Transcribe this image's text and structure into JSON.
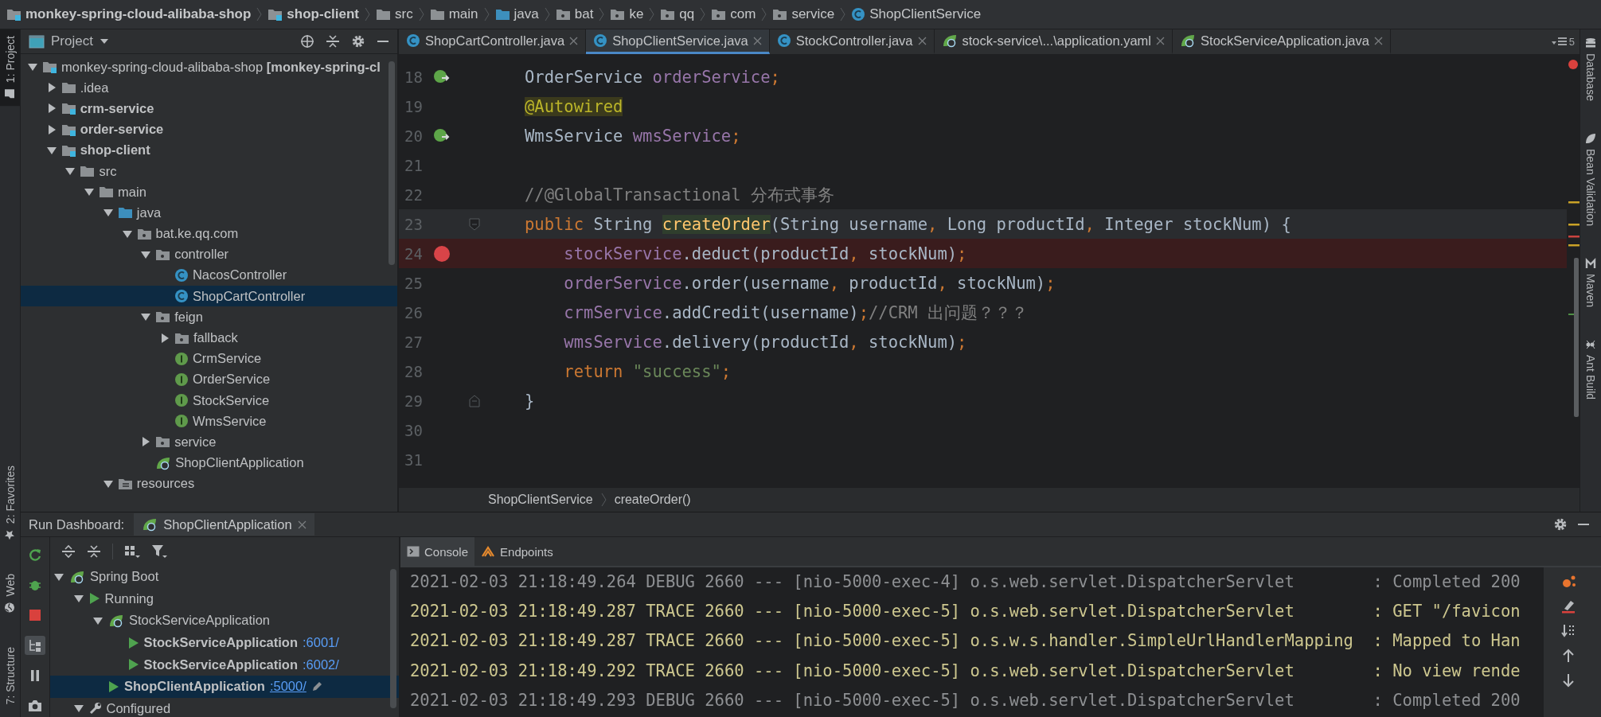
{
  "breadcrumb": [
    {
      "label": "monkey-spring-cloud-alibaba-shop",
      "kind": "module"
    },
    {
      "label": "shop-client",
      "kind": "module"
    },
    {
      "label": "src",
      "kind": "folder"
    },
    {
      "label": "main",
      "kind": "folder"
    },
    {
      "label": "java",
      "kind": "source"
    },
    {
      "label": "bat",
      "kind": "package"
    },
    {
      "label": "ke",
      "kind": "package"
    },
    {
      "label": "qq",
      "kind": "package"
    },
    {
      "label": "com",
      "kind": "package"
    },
    {
      "label": "service",
      "kind": "package"
    },
    {
      "label": "ShopClientService",
      "kind": "class"
    }
  ],
  "left_strip": [
    {
      "label": "1: Project",
      "kind": "project",
      "selected": true
    },
    {
      "label": "2: Favorites",
      "kind": "favorites",
      "selected": false
    },
    {
      "label": "Web",
      "kind": "web",
      "selected": false
    },
    {
      "label": "7: Structure",
      "kind": "structure",
      "selected": false
    }
  ],
  "project_panel": {
    "title": "Project",
    "tree": [
      {
        "label": "monkey-spring-cloud-alibaba-shop **[monkey-spring-cl**",
        "kind": "project",
        "expanded": true,
        "selected": false,
        "children": [
          {
            "label": ".idea",
            "kind": "folder",
            "expanded": false,
            "selected": false
          },
          {
            "label": "crm-service",
            "kind": "module",
            "expanded": false,
            "selected": false
          },
          {
            "label": "order-service",
            "kind": "module",
            "expanded": false,
            "selected": false
          },
          {
            "label": "shop-client",
            "kind": "module",
            "expanded": true,
            "selected": false,
            "children": [
              {
                "label": "src",
                "kind": "folder",
                "expanded": true,
                "selected": false,
                "children": [
                  {
                    "label": "main",
                    "kind": "folder",
                    "expanded": true,
                    "selected": false,
                    "children": [
                      {
                        "label": "java",
                        "kind": "source",
                        "expanded": true,
                        "selected": false,
                        "children": [
                          {
                            "label": "bat.ke.qq.com",
                            "kind": "package",
                            "expanded": true,
                            "selected": false,
                            "children": [
                              {
                                "label": "controller",
                                "kind": "package",
                                "expanded": true,
                                "selected": false,
                                "children": [
                                  {
                                    "label": "NacosController",
                                    "kind": "class",
                                    "selected": false
                                  },
                                  {
                                    "label": "ShopCartController",
                                    "kind": "class",
                                    "selected": true
                                  }
                                ]
                              },
                              {
                                "label": "feign",
                                "kind": "package",
                                "expanded": true,
                                "selected": false,
                                "children": [
                                  {
                                    "label": "fallback",
                                    "kind": "package",
                                    "expanded": false,
                                    "selected": false
                                  },
                                  {
                                    "label": "CrmService",
                                    "kind": "interface",
                                    "selected": false
                                  },
                                  {
                                    "label": "OrderService",
                                    "kind": "interface",
                                    "selected": false
                                  },
                                  {
                                    "label": "StockService",
                                    "kind": "interface",
                                    "selected": false
                                  },
                                  {
                                    "label": "WmsService",
                                    "kind": "interface",
                                    "selected": false
                                  }
                                ]
                              },
                              {
                                "label": "service",
                                "kind": "package",
                                "expanded": false,
                                "selected": false
                              },
                              {
                                "label": "ShopClientApplication",
                                "kind": "app",
                                "selected": false
                              }
                            ]
                          }
                        ]
                      },
                      {
                        "label": "resources",
                        "kind": "resources",
                        "expanded": true,
                        "selected": false
                      }
                    ]
                  }
                ]
              }
            ]
          }
        ]
      }
    ]
  },
  "editor": {
    "tabs": [
      {
        "label": "ShopCartController.java",
        "kind": "class",
        "selected": false
      },
      {
        "label": "ShopClientService.java",
        "kind": "class",
        "selected": true
      },
      {
        "label": "StockController.java",
        "kind": "class",
        "selected": false
      },
      {
        "label": "stock-service\\...\\application.yaml",
        "kind": "config",
        "selected": false
      },
      {
        "label": "StockServiceApplication.java",
        "kind": "app",
        "selected": false
      }
    ],
    "tab_count": "5",
    "lines": [
      {
        "number": "18",
        "kind": "bean",
        "current": false,
        "tokens": [
          {
            "text": "OrderService ",
            "kind": "plain"
          },
          {
            "text": "orderService",
            "kind": "field"
          },
          {
            "text": ";",
            "kind": "kw"
          }
        ]
      },
      {
        "number": "19",
        "kind": "plain",
        "current": false,
        "tokens": [
          {
            "text": "@Autowired",
            "kind": "ann"
          }
        ]
      },
      {
        "number": "20",
        "kind": "bean",
        "current": false,
        "tokens": [
          {
            "text": "WmsService ",
            "kind": "plain"
          },
          {
            "text": "wmsService",
            "kind": "field"
          },
          {
            "text": ";",
            "kind": "kw"
          }
        ]
      },
      {
        "number": "21",
        "kind": "plain",
        "current": false
      },
      {
        "number": "22",
        "kind": "plain",
        "current": false,
        "tokens": [
          {
            "text": "//@GlobalTransactional 分布式事务",
            "kind": "comment"
          }
        ]
      },
      {
        "number": "23",
        "kind": "fold-start",
        "current": true,
        "tokens": [
          {
            "text": "public ",
            "kind": "kw"
          },
          {
            "text": "String ",
            "kind": "plain"
          },
          {
            "text": "createOrder",
            "kind": "decl"
          },
          {
            "text": "(String username",
            "kind": "plain"
          },
          {
            "text": ", ",
            "kind": "kw"
          },
          {
            "text": "Long productId",
            "kind": "plain"
          },
          {
            "text": ", ",
            "kind": "kw"
          },
          {
            "text": "Integer stockNum) {",
            "kind": "plain"
          }
        ]
      },
      {
        "number": "24",
        "kind": "breakpoint",
        "current": false,
        "tokens": [
          {
            "text": "    stockService",
            "kind": "field"
          },
          {
            "text": ".deduct(productId",
            "kind": "plain"
          },
          {
            "text": ", ",
            "kind": "kw"
          },
          {
            "text": "stockNum)",
            "kind": "plain"
          },
          {
            "text": ";",
            "kind": "kw"
          }
        ]
      },
      {
        "number": "25",
        "kind": "plain",
        "current": false,
        "tokens": [
          {
            "text": "    orderService",
            "kind": "field"
          },
          {
            "text": ".order(username",
            "kind": "plain"
          },
          {
            "text": ", ",
            "kind": "kw"
          },
          {
            "text": "productId",
            "kind": "plain"
          },
          {
            "text": ", ",
            "kind": "kw"
          },
          {
            "text": "stockNum)",
            "kind": "plain"
          },
          {
            "text": ";",
            "kind": "kw"
          }
        ]
      },
      {
        "number": "26",
        "kind": "plain",
        "current": false,
        "tokens": [
          {
            "text": "    crmService",
            "kind": "field"
          },
          {
            "text": ".addCredit(username)",
            "kind": "plain"
          },
          {
            "text": ";",
            "kind": "kw"
          },
          {
            "text": "//CRM 出问题？？？",
            "kind": "comment"
          }
        ]
      },
      {
        "number": "27",
        "kind": "plain",
        "current": false,
        "tokens": [
          {
            "text": "    wmsService",
            "kind": "field"
          },
          {
            "text": ".delivery(productId",
            "kind": "plain"
          },
          {
            "text": ", ",
            "kind": "kw"
          },
          {
            "text": "stockNum)",
            "kind": "plain"
          },
          {
            "text": ";",
            "kind": "kw"
          }
        ]
      },
      {
        "number": "28",
        "kind": "plain",
        "current": false,
        "tokens": [
          {
            "text": "    return ",
            "kind": "kw"
          },
          {
            "text": "\"success\"",
            "kind": "str"
          },
          {
            "text": ";",
            "kind": "kw"
          }
        ]
      },
      {
        "number": "29",
        "kind": "fold-end",
        "current": false,
        "tokens": [
          {
            "text": "}",
            "kind": "plain"
          }
        ]
      },
      {
        "number": "30",
        "kind": "plain",
        "current": false
      },
      {
        "number": "31",
        "kind": "plain",
        "current": false
      }
    ],
    "breadcrumb": [
      "ShopClientService",
      "createOrder()"
    ]
  },
  "right_strip": [
    {
      "label": "Database",
      "kind": "database"
    },
    {
      "label": "Bean Validation",
      "kind": "bean"
    },
    {
      "label": "Maven",
      "kind": "maven"
    },
    {
      "label": "Ant Build",
      "kind": "ant"
    }
  ],
  "run_dashboard": {
    "title": "Run Dashboard:",
    "tab": "ShopClientApplication",
    "tree": [
      {
        "label": "Spring Boot",
        "kind": "group",
        "expanded": true,
        "selected": false,
        "children": [
          {
            "label": "Running",
            "kind": "status",
            "expanded": true,
            "selected": false,
            "children": [
              {
                "label": "StockServiceApplication",
                "kind": "app",
                "expanded": true,
                "selected": false,
                "children": [
                  {
                    "label": "StockServiceApplication",
                    "port": ":6001/",
                    "kind": "instance",
                    "selected": false
                  },
                  {
                    "label": "StockServiceApplication",
                    "port": ":6002/",
                    "kind": "instance",
                    "selected": false
                  }
                ]
              },
              {
                "label": "ShopClientApplication",
                "port": ":5000/",
                "kind": "instance",
                "selected": true
              }
            ]
          },
          {
            "label": "Configured",
            "kind": "configured",
            "expanded": true,
            "selected": false
          }
        ]
      }
    ],
    "console_tabs": [
      {
        "label": "Console",
        "kind": "console",
        "selected": true
      },
      {
        "label": "Endpoints",
        "kind": "endpoints",
        "selected": false
      }
    ],
    "console_lines": [
      {
        "text": "2021-02-03 21:18:49.264 DEBUG 2660 --- [nio-5000-exec-4] o.s.web.servlet.DispatcherServlet        : Completed 200",
        "kind": "debug"
      },
      {
        "text": "2021-02-03 21:18:49.287 TRACE 2660 --- [nio-5000-exec-5] o.s.web.servlet.DispatcherServlet        : GET \"/favicon",
        "kind": "trace"
      },
      {
        "text": "2021-02-03 21:18:49.287 TRACE 2660 --- [nio-5000-exec-5] o.s.w.s.handler.SimpleUrlHandlerMapping  : Mapped to Han",
        "kind": "trace"
      },
      {
        "text": "2021-02-03 21:18:49.292 TRACE 2660 --- [nio-5000-exec-5] o.s.web.servlet.DispatcherServlet        : No view rende",
        "kind": "trace"
      },
      {
        "text": "2021-02-03 21:18:49.293 DEBUG 2660 --- [nio-5000-exec-5] o.s.web.servlet.DispatcherServlet        : Completed 200",
        "kind": "debug"
      }
    ]
  }
}
